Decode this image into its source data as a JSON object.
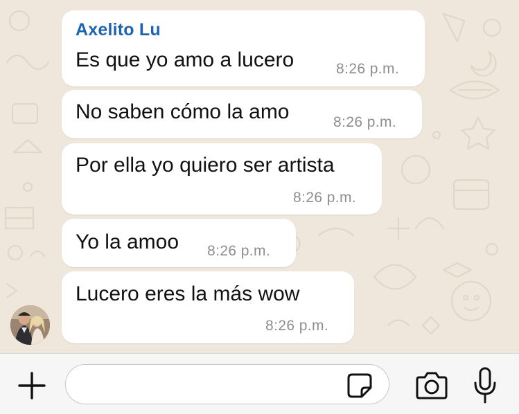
{
  "chat": {
    "sender": "Axelito Lu",
    "messages": [
      {
        "text": "Es que yo amo a lucero",
        "time": "8:26 p.m."
      },
      {
        "text": "No saben cómo la amo",
        "time": "8:26 p.m."
      },
      {
        "text": "Por ella yo quiero ser artista",
        "time": "8:26 p.m."
      },
      {
        "text": "Yo la amoo",
        "time": "8:26 p.m."
      },
      {
        "text": "Lucero eres la más wow",
        "time": "8:26 p.m."
      }
    ]
  },
  "input_bar": {
    "message_value": "",
    "icons": [
      "plus-icon",
      "sticker-icon",
      "camera-icon",
      "microphone-icon"
    ]
  },
  "colors": {
    "chat_background": "#efe7dc",
    "bubble": "#ffffff",
    "sender_name": "#1f63b3",
    "timestamp": "#8e8e8e"
  }
}
